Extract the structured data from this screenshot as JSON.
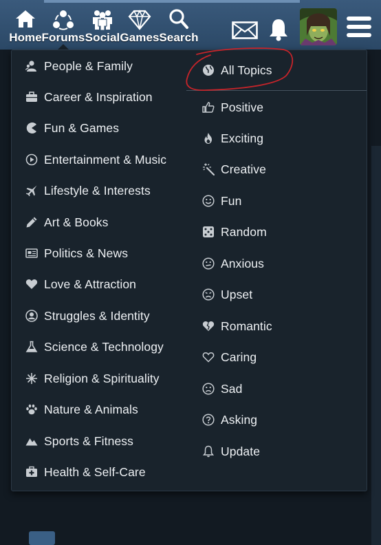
{
  "nav": {
    "items": [
      {
        "label": "Home",
        "icon": "home-icon"
      },
      {
        "label": "Forums",
        "icon": "forums-icon"
      },
      {
        "label": "Social",
        "icon": "social-icon"
      },
      {
        "label": "Games",
        "icon": "games-icon"
      },
      {
        "label": "Search",
        "icon": "search-icon"
      }
    ],
    "right_icons": [
      "mail-icon",
      "bell-icon",
      "menu-icon"
    ]
  },
  "categories": [
    {
      "label": "People & Family",
      "icon": "people-icon"
    },
    {
      "label": "Career & Inspiration",
      "icon": "briefcase-icon"
    },
    {
      "label": "Fun & Games",
      "icon": "pacman-icon"
    },
    {
      "label": "Entertainment & Music",
      "icon": "play-icon"
    },
    {
      "label": "Lifestyle & Interests",
      "icon": "plane-icon"
    },
    {
      "label": "Art & Books",
      "icon": "pencil-icon"
    },
    {
      "label": "Politics & News",
      "icon": "newspaper-icon"
    },
    {
      "label": "Love & Attraction",
      "icon": "heart-icon"
    },
    {
      "label": "Struggles & Identity",
      "icon": "user-circle-icon"
    },
    {
      "label": "Science & Technology",
      "icon": "flask-icon"
    },
    {
      "label": "Religion & Spirituality",
      "icon": "sparkle-icon"
    },
    {
      "label": "Nature & Animals",
      "icon": "paw-icon"
    },
    {
      "label": "Sports & Fitness",
      "icon": "mountain-icon"
    },
    {
      "label": "Health & Self-Care",
      "icon": "first-aid-icon"
    }
  ],
  "topics": [
    {
      "label": "All Topics",
      "icon": "globe-icon"
    },
    {
      "label": "Positive",
      "icon": "thumbs-up-icon"
    },
    {
      "label": "Exciting",
      "icon": "fire-icon"
    },
    {
      "label": "Creative",
      "icon": "magic-wand-icon"
    },
    {
      "label": "Fun",
      "icon": "smile-icon"
    },
    {
      "label": "Random",
      "icon": "dice-icon"
    },
    {
      "label": "Anxious",
      "icon": "meh-icon"
    },
    {
      "label": "Upset",
      "icon": "frown-icon"
    },
    {
      "label": "Romantic",
      "icon": "heart-broken-icon"
    },
    {
      "label": "Caring",
      "icon": "heart-outline-icon"
    },
    {
      "label": "Sad",
      "icon": "sad-icon"
    },
    {
      "label": "Asking",
      "icon": "question-icon"
    },
    {
      "label": "Update",
      "icon": "bell-small-icon"
    }
  ],
  "colors": {
    "nav_bg": "#2f4d6c",
    "dropdown_bg": "#19232c",
    "text": "#eef1f4",
    "icon": "#c8cdd2",
    "annotation": "#c8242a"
  }
}
